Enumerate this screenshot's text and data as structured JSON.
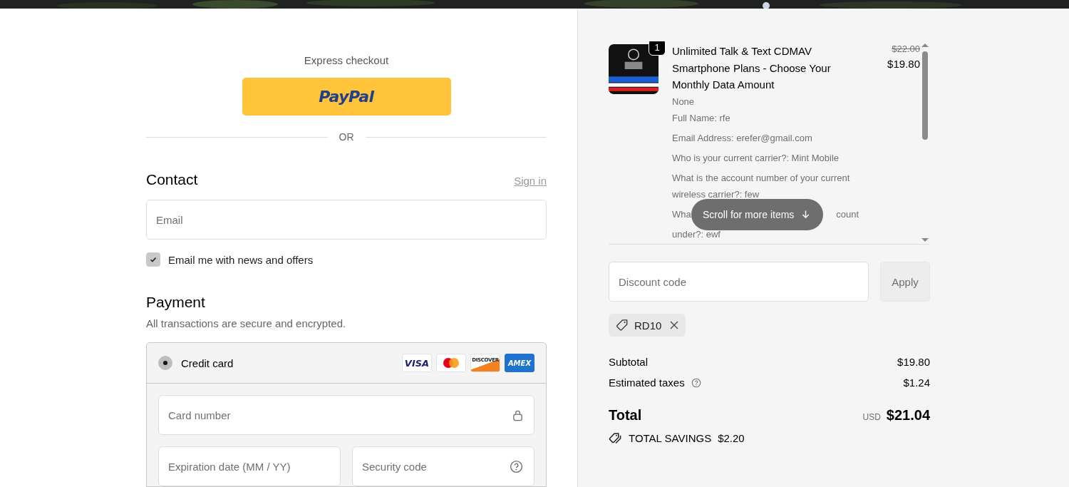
{
  "express_checkout": {
    "label": "Express checkout",
    "button": "PayPal"
  },
  "divider": "OR",
  "contact": {
    "heading": "Contact",
    "sign_in": "Sign in",
    "email_placeholder": "Email",
    "newsletter": {
      "label": "Email me with news and offers",
      "checked": true
    }
  },
  "payment": {
    "heading": "Payment",
    "subtitle": "All transactions are secure and encrypted.",
    "methods": [
      {
        "label": "Credit card",
        "selected": true,
        "card_logos": [
          {
            "kind": "visa",
            "text": "VISA"
          },
          {
            "kind": "mastercard"
          },
          {
            "kind": "discover",
            "text": "DISCOVER"
          },
          {
            "kind": "amex",
            "text": "AMEX"
          }
        ],
        "fields": [
          {
            "kind": "card",
            "placeholder": "Card number"
          },
          {
            "kind": "expiry",
            "placeholder": "Expiration date (MM / YY)"
          },
          {
            "kind": "cvc",
            "placeholder": "Security code"
          }
        ]
      }
    ]
  },
  "order_items": [
    {
      "quantity": "1",
      "title": "Unlimited Talk & Text CDMAV Smartphone Plans - Choose Your Monthly Data Amount",
      "original_price": "$22.00",
      "price": "$19.80",
      "details": [
        {
          "kind": "text",
          "text": "None"
        },
        {
          "kind": "text",
          "text": "Full Name: rfe"
        },
        {
          "kind": "text",
          "text": "Email Address: erefer@gmail.com"
        },
        {
          "kind": "text",
          "text": "Who is your current carrier?: Mint Mobile"
        },
        {
          "kind": "text",
          "text": "What is the account number of your current wireless carrier?: few"
        },
        {
          "kind": "covered",
          "start": "Wha",
          "end": "count"
        },
        {
          "kind": "text",
          "text": "under?: ewf"
        }
      ]
    }
  ],
  "scroll_hint": "Scroll for more items",
  "discount": {
    "placeholder": "Discount code",
    "button": "Apply",
    "applied_codes": [
      {
        "code": "RD10"
      }
    ]
  },
  "totals": {
    "rows": [
      {
        "kind": "plain",
        "label": "Subtotal",
        "value": "$19.80"
      },
      {
        "kind": "help",
        "label": "Estimated taxes",
        "value": "$1.24"
      }
    ],
    "total_label": "Total",
    "currency": "USD",
    "total": "$21.04",
    "savings_label": "TOTAL SAVINGS",
    "savings": "$2.20"
  }
}
